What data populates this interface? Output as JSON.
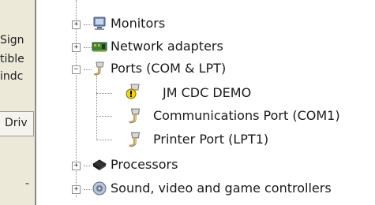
{
  "left_panel": {
    "line1": "Sign",
    "line2": "tible",
    "line3": "indc",
    "tab_label": "Driv",
    "dash": "-"
  },
  "tree": {
    "items": [
      {
        "label": "Monitors",
        "icon": "monitor-icon",
        "expander": "+"
      },
      {
        "label": "Network adapters",
        "icon": "network-adapter-icon",
        "expander": "+"
      },
      {
        "label": "Ports (COM & LPT)",
        "icon": "port-icon",
        "expander": "−"
      },
      {
        "label": "JM CDC DEMO",
        "icon": "warning-port-icon",
        "expander": ""
      },
      {
        "label": "Communications Port (COM1)",
        "icon": "port-icon",
        "expander": ""
      },
      {
        "label": "Printer Port (LPT1)",
        "icon": "port-icon",
        "expander": ""
      },
      {
        "label": "Processors",
        "icon": "processor-icon",
        "expander": "+"
      },
      {
        "label": "Sound, video and game controllers",
        "icon": "sound-icon",
        "expander": "+"
      }
    ]
  }
}
